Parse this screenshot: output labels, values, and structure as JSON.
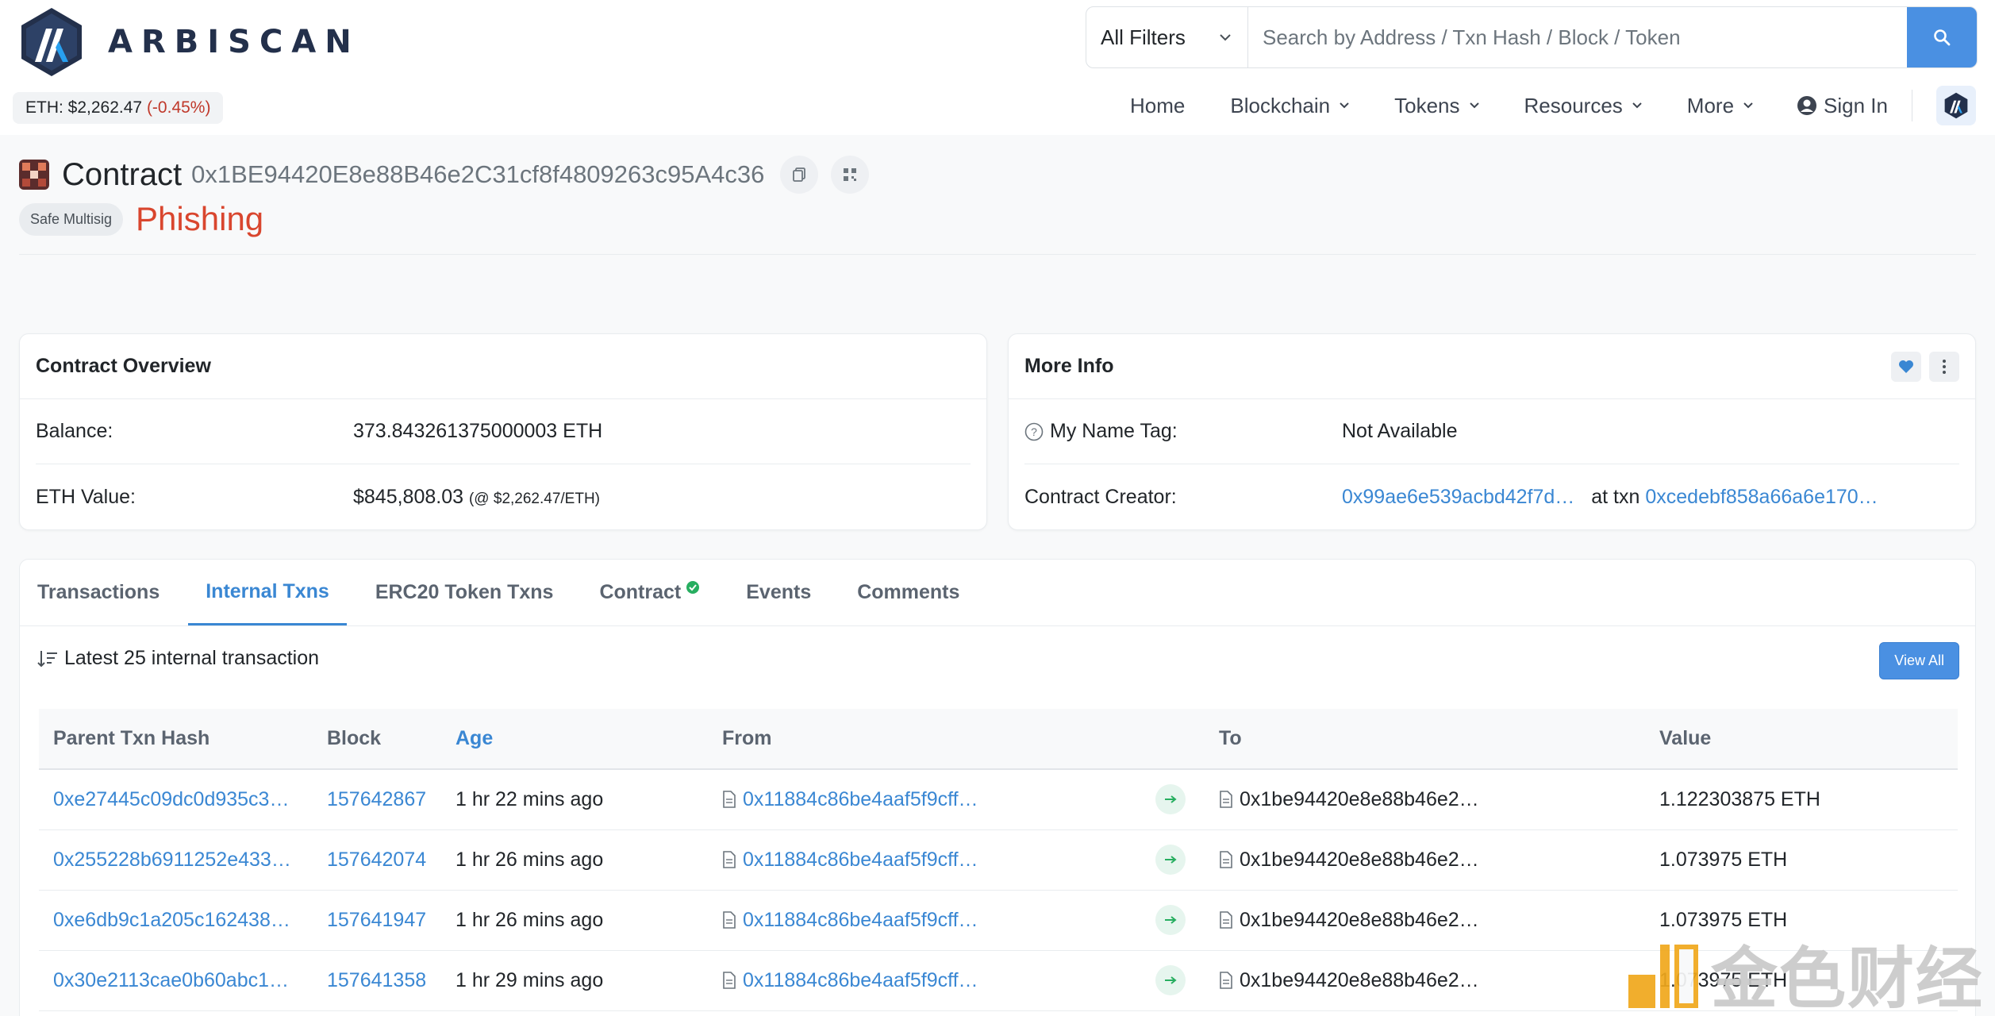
{
  "brand": {
    "name": "ARBISCAN",
    "colors": {
      "primary": "#4a90e2",
      "link": "#3a87d3",
      "danger": "#d9462e",
      "success": "#27ae60"
    }
  },
  "price": {
    "label": "ETH: $2,262.47",
    "change": "(-0.45%)"
  },
  "search": {
    "filter": "All Filters",
    "placeholder": "Search by Address / Txn Hash / Block / Token"
  },
  "nav": {
    "items": [
      "Home",
      "Blockchain",
      "Tokens",
      "Resources",
      "More"
    ],
    "sign_in": "Sign In"
  },
  "page": {
    "type_label": "Contract",
    "address": "0x1BE94420E8e88B46e2C31cf8f4809263c95A4c36",
    "badge": "Safe Multisig",
    "warning": "Phishing"
  },
  "overview": {
    "title": "Contract Overview",
    "balance_label": "Balance:",
    "balance_value": "373.843261375000003 ETH",
    "eth_value_label": "ETH Value:",
    "eth_value": "$845,808.03",
    "eth_value_rate": "(@ $2,262.47/ETH)"
  },
  "more_info": {
    "title": "More Info",
    "name_tag_label": "My Name Tag:",
    "name_tag_value": "Not Available",
    "creator_label": "Contract Creator:",
    "creator_address": "0x99ae6e539acbd42f7d…",
    "at_txn_label": "at txn",
    "creator_txn": "0xcedebf858a66a6e170…"
  },
  "tabs": {
    "items": [
      "Transactions",
      "Internal Txns",
      "ERC20 Token Txns",
      "Contract",
      "Events",
      "Comments"
    ],
    "active": "Internal Txns"
  },
  "list": {
    "summary": "Latest 25 internal transaction",
    "view_all": "View All",
    "columns": [
      "Parent Txn Hash",
      "Block",
      "Age",
      "From",
      "To",
      "Value"
    ],
    "rows": [
      {
        "hash": "0xe27445c09dc0d935c3…",
        "block": "157642867",
        "age": "1 hr 22 mins ago",
        "from": "0x11884c86be4aaf5f9cff…",
        "to": "0x1be94420e8e88b46e2…",
        "value": "1.122303875 ETH"
      },
      {
        "hash": "0x255228b6911252e433…",
        "block": "157642074",
        "age": "1 hr 26 mins ago",
        "from": "0x11884c86be4aaf5f9cff…",
        "to": "0x1be94420e8e88b46e2…",
        "value": "1.073975 ETH"
      },
      {
        "hash": "0xe6db9c1a205c162438…",
        "block": "157641947",
        "age": "1 hr 26 mins ago",
        "from": "0x11884c86be4aaf5f9cff…",
        "to": "0x1be94420e8e88b46e2…",
        "value": "1.073975 ETH"
      },
      {
        "hash": "0x30e2113cae0b60abc1…",
        "block": "157641358",
        "age": "1 hr 29 mins ago",
        "from": "0x11884c86be4aaf5f9cff…",
        "to": "0x1be94420e8e88b46e2…",
        "value": "1.073975 ETH"
      }
    ]
  },
  "watermark": {
    "text": "金色财经"
  }
}
